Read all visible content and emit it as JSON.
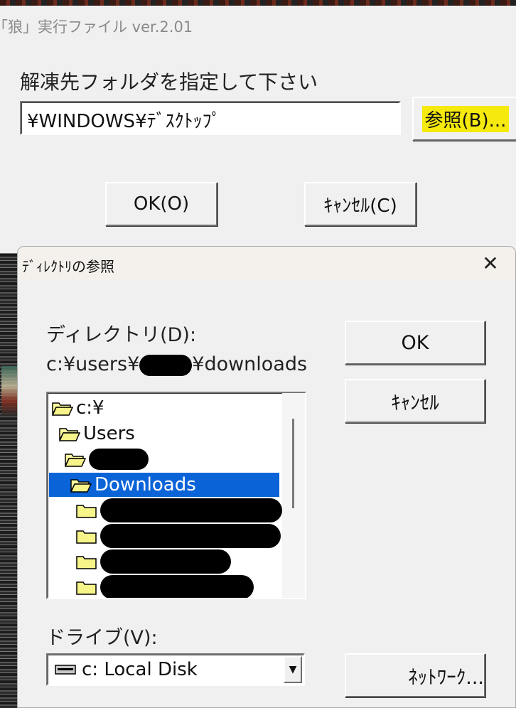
{
  "app": {
    "title": "「狼」実行ファイル ver.2.01",
    "prompt": "解凍先フォルダを指定して下さい",
    "path_value": "¥WINDOWS¥ﾃﾞｽｸﾄｯﾌﾟ",
    "browse_label": "参照(B)...",
    "ok_label": "OK(O)",
    "cancel_label": "ｷｬﾝｾﾙ(C)"
  },
  "dialog": {
    "title": "ﾃﾞｨﾚｸﾄﾘの参照",
    "directory_label": "ディレクトリ(D):",
    "current_path_prefix": "c:¥users¥",
    "current_path_suffix": "¥downloads",
    "tree": [
      {
        "label": "c:¥",
        "icon": "open-folder-icon",
        "selected": false
      },
      {
        "label": "Users",
        "icon": "open-folder-icon",
        "selected": false
      },
      {
        "label": "",
        "icon": "open-folder-icon",
        "selected": false,
        "redacted": true
      },
      {
        "label": "Downloads",
        "icon": "open-folder-icon",
        "selected": true
      },
      {
        "label": "",
        "icon": "folder-icon",
        "selected": false,
        "redacted": true
      },
      {
        "label": "",
        "icon": "folder-icon",
        "selected": false,
        "redacted": true
      },
      {
        "label": "",
        "icon": "folder-icon",
        "selected": false,
        "redacted": true
      },
      {
        "label": "",
        "icon": "folder-icon",
        "selected": false,
        "redacted": true
      }
    ],
    "ok_label": "OK",
    "cancel_label": "ｷｬﾝｾﾙ",
    "drive_label": "ドライブ(V):",
    "drive_value": "c: Local Disk",
    "network_label": "ﾈｯﾄﾜｰｸ...",
    "selection_color": "#0a64d8",
    "highlight_color": "#f5e90d"
  }
}
